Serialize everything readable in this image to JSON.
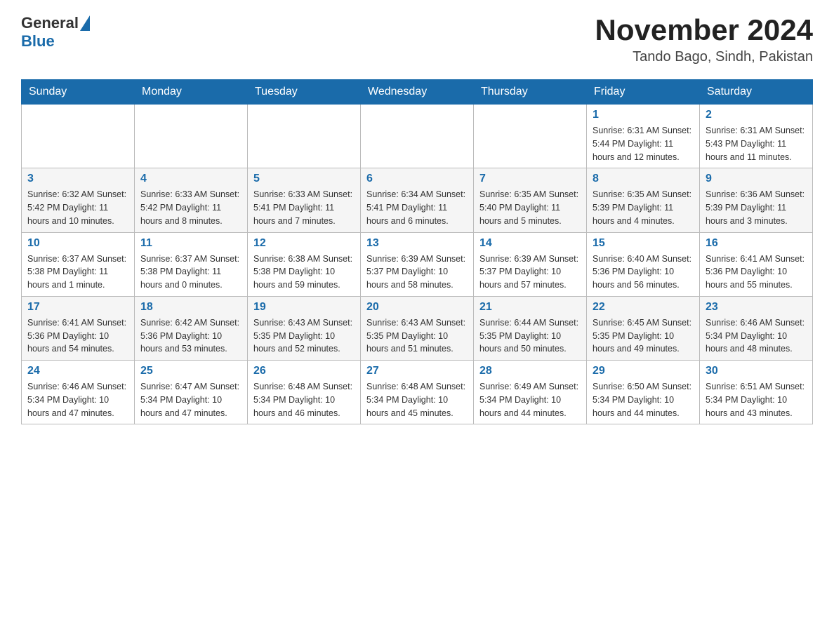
{
  "header": {
    "logo_general": "General",
    "logo_blue": "Blue",
    "month_title": "November 2024",
    "location": "Tando Bago, Sindh, Pakistan"
  },
  "days_of_week": [
    "Sunday",
    "Monday",
    "Tuesday",
    "Wednesday",
    "Thursday",
    "Friday",
    "Saturday"
  ],
  "weeks": [
    [
      {
        "day": "",
        "info": ""
      },
      {
        "day": "",
        "info": ""
      },
      {
        "day": "",
        "info": ""
      },
      {
        "day": "",
        "info": ""
      },
      {
        "day": "",
        "info": ""
      },
      {
        "day": "1",
        "info": "Sunrise: 6:31 AM\nSunset: 5:44 PM\nDaylight: 11 hours and 12 minutes."
      },
      {
        "day": "2",
        "info": "Sunrise: 6:31 AM\nSunset: 5:43 PM\nDaylight: 11 hours and 11 minutes."
      }
    ],
    [
      {
        "day": "3",
        "info": "Sunrise: 6:32 AM\nSunset: 5:42 PM\nDaylight: 11 hours and 10 minutes."
      },
      {
        "day": "4",
        "info": "Sunrise: 6:33 AM\nSunset: 5:42 PM\nDaylight: 11 hours and 8 minutes."
      },
      {
        "day": "5",
        "info": "Sunrise: 6:33 AM\nSunset: 5:41 PM\nDaylight: 11 hours and 7 minutes."
      },
      {
        "day": "6",
        "info": "Sunrise: 6:34 AM\nSunset: 5:41 PM\nDaylight: 11 hours and 6 minutes."
      },
      {
        "day": "7",
        "info": "Sunrise: 6:35 AM\nSunset: 5:40 PM\nDaylight: 11 hours and 5 minutes."
      },
      {
        "day": "8",
        "info": "Sunrise: 6:35 AM\nSunset: 5:39 PM\nDaylight: 11 hours and 4 minutes."
      },
      {
        "day": "9",
        "info": "Sunrise: 6:36 AM\nSunset: 5:39 PM\nDaylight: 11 hours and 3 minutes."
      }
    ],
    [
      {
        "day": "10",
        "info": "Sunrise: 6:37 AM\nSunset: 5:38 PM\nDaylight: 11 hours and 1 minute."
      },
      {
        "day": "11",
        "info": "Sunrise: 6:37 AM\nSunset: 5:38 PM\nDaylight: 11 hours and 0 minutes."
      },
      {
        "day": "12",
        "info": "Sunrise: 6:38 AM\nSunset: 5:38 PM\nDaylight: 10 hours and 59 minutes."
      },
      {
        "day": "13",
        "info": "Sunrise: 6:39 AM\nSunset: 5:37 PM\nDaylight: 10 hours and 58 minutes."
      },
      {
        "day": "14",
        "info": "Sunrise: 6:39 AM\nSunset: 5:37 PM\nDaylight: 10 hours and 57 minutes."
      },
      {
        "day": "15",
        "info": "Sunrise: 6:40 AM\nSunset: 5:36 PM\nDaylight: 10 hours and 56 minutes."
      },
      {
        "day": "16",
        "info": "Sunrise: 6:41 AM\nSunset: 5:36 PM\nDaylight: 10 hours and 55 minutes."
      }
    ],
    [
      {
        "day": "17",
        "info": "Sunrise: 6:41 AM\nSunset: 5:36 PM\nDaylight: 10 hours and 54 minutes."
      },
      {
        "day": "18",
        "info": "Sunrise: 6:42 AM\nSunset: 5:36 PM\nDaylight: 10 hours and 53 minutes."
      },
      {
        "day": "19",
        "info": "Sunrise: 6:43 AM\nSunset: 5:35 PM\nDaylight: 10 hours and 52 minutes."
      },
      {
        "day": "20",
        "info": "Sunrise: 6:43 AM\nSunset: 5:35 PM\nDaylight: 10 hours and 51 minutes."
      },
      {
        "day": "21",
        "info": "Sunrise: 6:44 AM\nSunset: 5:35 PM\nDaylight: 10 hours and 50 minutes."
      },
      {
        "day": "22",
        "info": "Sunrise: 6:45 AM\nSunset: 5:35 PM\nDaylight: 10 hours and 49 minutes."
      },
      {
        "day": "23",
        "info": "Sunrise: 6:46 AM\nSunset: 5:34 PM\nDaylight: 10 hours and 48 minutes."
      }
    ],
    [
      {
        "day": "24",
        "info": "Sunrise: 6:46 AM\nSunset: 5:34 PM\nDaylight: 10 hours and 47 minutes."
      },
      {
        "day": "25",
        "info": "Sunrise: 6:47 AM\nSunset: 5:34 PM\nDaylight: 10 hours and 47 minutes."
      },
      {
        "day": "26",
        "info": "Sunrise: 6:48 AM\nSunset: 5:34 PM\nDaylight: 10 hours and 46 minutes."
      },
      {
        "day": "27",
        "info": "Sunrise: 6:48 AM\nSunset: 5:34 PM\nDaylight: 10 hours and 45 minutes."
      },
      {
        "day": "28",
        "info": "Sunrise: 6:49 AM\nSunset: 5:34 PM\nDaylight: 10 hours and 44 minutes."
      },
      {
        "day": "29",
        "info": "Sunrise: 6:50 AM\nSunset: 5:34 PM\nDaylight: 10 hours and 44 minutes."
      },
      {
        "day": "30",
        "info": "Sunrise: 6:51 AM\nSunset: 5:34 PM\nDaylight: 10 hours and 43 minutes."
      }
    ]
  ]
}
